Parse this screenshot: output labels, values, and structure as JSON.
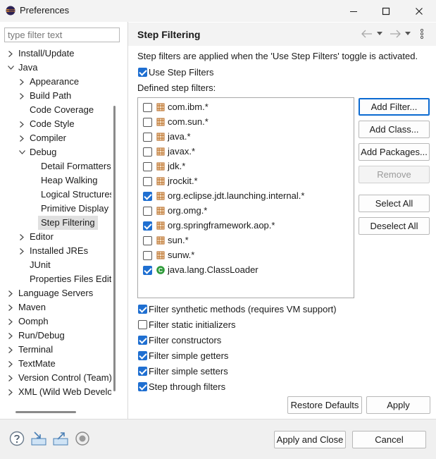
{
  "window": {
    "title": "Preferences",
    "minimize_icon": "minimize-icon",
    "maximize_icon": "maximize-icon",
    "close_icon": "close-icon"
  },
  "sidebar": {
    "filter_placeholder": "type filter text",
    "items": [
      {
        "label": "Install/Update",
        "level": 0,
        "expand": "collapsed"
      },
      {
        "label": "Java",
        "level": 0,
        "expand": "expanded"
      },
      {
        "label": "Appearance",
        "level": 1,
        "expand": "collapsed"
      },
      {
        "label": "Build Path",
        "level": 1,
        "expand": "collapsed"
      },
      {
        "label": "Code Coverage",
        "level": 1,
        "expand": "none"
      },
      {
        "label": "Code Style",
        "level": 1,
        "expand": "collapsed"
      },
      {
        "label": "Compiler",
        "level": 1,
        "expand": "collapsed"
      },
      {
        "label": "Debug",
        "level": 1,
        "expand": "expanded"
      },
      {
        "label": "Detail Formatters",
        "level": 2,
        "expand": "none"
      },
      {
        "label": "Heap Walking",
        "level": 2,
        "expand": "none"
      },
      {
        "label": "Logical Structures",
        "level": 2,
        "expand": "none"
      },
      {
        "label": "Primitive Display",
        "level": 2,
        "expand": "none"
      },
      {
        "label": "Step Filtering",
        "level": 2,
        "expand": "none",
        "selected": true
      },
      {
        "label": "Editor",
        "level": 1,
        "expand": "collapsed"
      },
      {
        "label": "Installed JREs",
        "level": 1,
        "expand": "collapsed"
      },
      {
        "label": "JUnit",
        "level": 1,
        "expand": "none"
      },
      {
        "label": "Properties Files Editor",
        "level": 1,
        "expand": "none"
      },
      {
        "label": "Language Servers",
        "level": 0,
        "expand": "collapsed"
      },
      {
        "label": "Maven",
        "level": 0,
        "expand": "collapsed"
      },
      {
        "label": "Oomph",
        "level": 0,
        "expand": "collapsed"
      },
      {
        "label": "Run/Debug",
        "level": 0,
        "expand": "collapsed"
      },
      {
        "label": "Terminal",
        "level": 0,
        "expand": "collapsed"
      },
      {
        "label": "TextMate",
        "level": 0,
        "expand": "collapsed"
      },
      {
        "label": "Version Control (Team)",
        "level": 0,
        "expand": "collapsed"
      },
      {
        "label": "XML (Wild Web Developer)",
        "level": 0,
        "expand": "collapsed"
      }
    ]
  },
  "page": {
    "title": "Step Filtering",
    "description": "Step filters are applied when the 'Use Step Filters' toggle is activated.",
    "use_step_filters": {
      "label": "Use Step Filters",
      "checked": true
    },
    "defined_label": "Defined step filters:",
    "filters": [
      {
        "name": "com.ibm.*",
        "checked": false,
        "icon": "package-icon"
      },
      {
        "name": "com.sun.*",
        "checked": false,
        "icon": "package-icon"
      },
      {
        "name": "java.*",
        "checked": false,
        "icon": "package-icon"
      },
      {
        "name": "javax.*",
        "checked": false,
        "icon": "package-icon"
      },
      {
        "name": "jdk.*",
        "checked": false,
        "icon": "package-icon"
      },
      {
        "name": "jrockit.*",
        "checked": false,
        "icon": "package-icon"
      },
      {
        "name": "org.eclipse.jdt.launching.internal.*",
        "checked": true,
        "icon": "package-icon"
      },
      {
        "name": "org.omg.*",
        "checked": false,
        "icon": "package-icon"
      },
      {
        "name": "org.springframework.aop.*",
        "checked": true,
        "icon": "package-icon"
      },
      {
        "name": "sun.*",
        "checked": false,
        "icon": "package-icon"
      },
      {
        "name": "sunw.*",
        "checked": false,
        "icon": "package-icon"
      },
      {
        "name": "java.lang.ClassLoader",
        "checked": true,
        "icon": "class-icon"
      }
    ],
    "side_buttons": {
      "add_filter": "Add Filter...",
      "add_class": "Add Class...",
      "add_packages": "Add Packages...",
      "remove": "Remove",
      "select_all": "Select All",
      "deselect_all": "Deselect All"
    },
    "options": [
      {
        "label": "Filter synthetic methods (requires VM support)",
        "checked": true
      },
      {
        "label": "Filter static initializers",
        "checked": false
      },
      {
        "label": "Filter constructors",
        "checked": true
      },
      {
        "label": "Filter simple getters",
        "checked": true
      },
      {
        "label": "Filter simple setters",
        "checked": true
      },
      {
        "label": "Step through filters",
        "checked": true
      }
    ],
    "restore_defaults": "Restore Defaults",
    "apply": "Apply"
  },
  "footer": {
    "apply_and_close": "Apply and Close",
    "cancel": "Cancel",
    "icons": [
      "help-icon",
      "import-icon",
      "export-icon",
      "record-icon"
    ]
  },
  "colors": {
    "accent": "#1f6fd1",
    "package": "#b5651d",
    "class": "#2e9b3a"
  }
}
